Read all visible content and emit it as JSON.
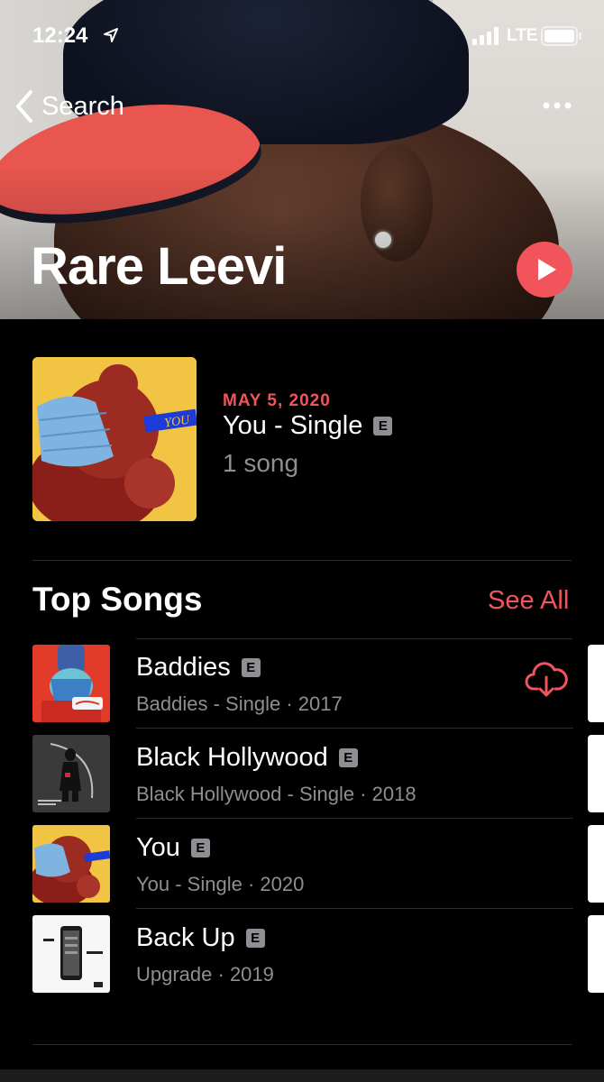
{
  "status_bar": {
    "time": "12:24",
    "network": "LTE"
  },
  "nav": {
    "back_label": "Search"
  },
  "artist": {
    "name": "Rare Leevi"
  },
  "latest_release": {
    "date": "MAY 5, 2020",
    "title": "You - Single",
    "explicit": "E",
    "song_count": "1 song",
    "art_text": "YOU"
  },
  "top_songs": {
    "heading": "Top Songs",
    "see_all_label": "See All",
    "items": [
      {
        "title": "Baddies",
        "explicit": "E",
        "subtitle": "Baddies - Single · 2017"
      },
      {
        "title": "Black Hollywood",
        "explicit": "E",
        "subtitle": "Black Hollywood - Single · 2018"
      },
      {
        "title": "You",
        "explicit": "E",
        "subtitle": "You - Single · 2020"
      },
      {
        "title": "Back Up",
        "explicit": "E",
        "subtitle": "Upgrade · 2019"
      }
    ]
  },
  "colors": {
    "accent": "#f2545b",
    "secondary_text": "#8e8e93",
    "background": "#000000"
  }
}
